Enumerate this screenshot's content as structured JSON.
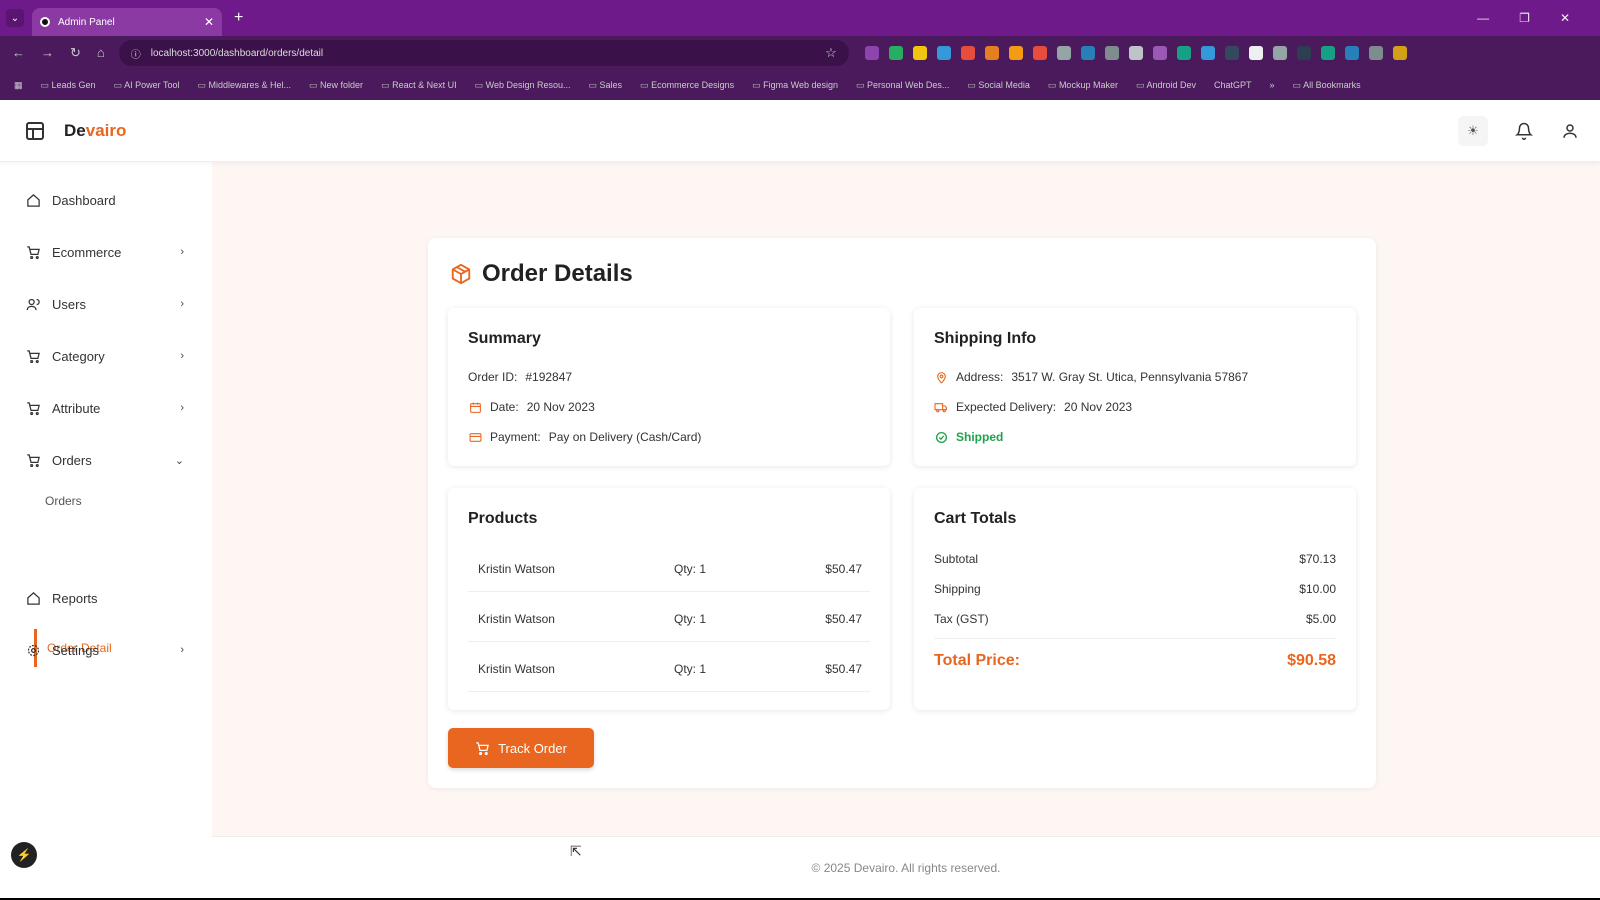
{
  "browser": {
    "tab_title": "Admin Panel",
    "url": "localhost:3000/dashboard/orders/detail",
    "bookmarks": [
      "Leads Gen",
      "AI Power Tool",
      "Middlewares & Hel...",
      "New folder",
      "React & Next UI",
      "Web Design Resou...",
      "Sales",
      "Ecommerce Designs",
      "Figma Web design",
      "Personal Web Des...",
      "Social Media",
      "Mockup Maker",
      "Android Dev",
      "ChatGPT",
      "All Bookmarks"
    ]
  },
  "header": {
    "brand_prefix": "De",
    "brand_suffix": "vairo"
  },
  "sidebar": {
    "items": [
      {
        "label": "Dashboard",
        "icon": "home-icon"
      },
      {
        "label": "Ecommerce",
        "icon": "cart-icon"
      },
      {
        "label": "Users",
        "icon": "users-icon"
      },
      {
        "label": "Category",
        "icon": "cart-icon"
      },
      {
        "label": "Attribute",
        "icon": "cart-icon"
      },
      {
        "label": "Orders",
        "icon": "cart-icon"
      },
      {
        "label": "Reports",
        "icon": "home-icon"
      },
      {
        "label": "Settings",
        "icon": "gear-icon"
      }
    ],
    "sub_items": {
      "orders": "Orders",
      "order_detail": "Order Detail"
    }
  },
  "order": {
    "title": "Order Details",
    "summary": {
      "heading": "Summary",
      "order_id_label": "Order ID:",
      "order_id": "#192847",
      "date_label": "Date:",
      "date": "20 Nov 2023",
      "payment_label": "Payment:",
      "payment": "Pay on Delivery (Cash/Card)"
    },
    "shipping": {
      "heading": "Shipping Info",
      "address_label": "Address:",
      "address": "3517 W. Gray St. Utica, Pennsylvania 57867",
      "delivery_label": "Expected Delivery:",
      "delivery": "20 Nov 2023",
      "status": "Shipped"
    },
    "products": {
      "heading": "Products",
      "rows": [
        {
          "name": "Kristin Watson",
          "qty": "Qty: 1",
          "price": "$50.47"
        },
        {
          "name": "Kristin Watson",
          "qty": "Qty: 1",
          "price": "$50.47"
        },
        {
          "name": "Kristin Watson",
          "qty": "Qty: 1",
          "price": "$50.47"
        }
      ]
    },
    "totals": {
      "heading": "Cart Totals",
      "subtotal_label": "Subtotal",
      "subtotal": "$70.13",
      "shipping_label": "Shipping",
      "shipping": "$10.00",
      "tax_label": "Tax (GST)",
      "tax": "$5.00",
      "total_label": "Total Price:",
      "total": "$90.58"
    },
    "track_button": "Track Order"
  },
  "footer": {
    "text": "© 2025 Devairo. All rights reserved."
  },
  "colors": {
    "accent": "#e8661f",
    "success": "#1ea34a",
    "browser_tab": "#6e1a8a"
  }
}
